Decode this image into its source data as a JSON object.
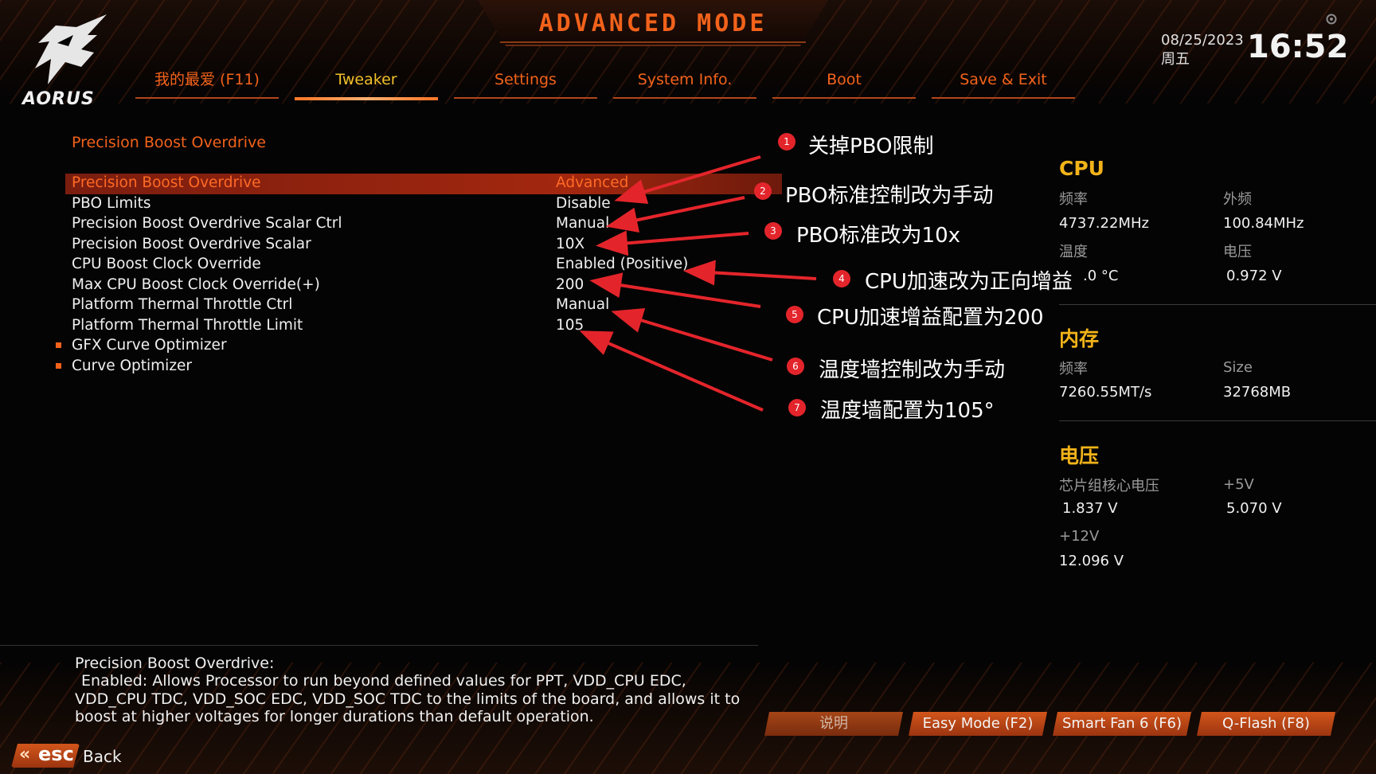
{
  "header": {
    "title": "ADVANCED MODE",
    "brand": "AORUS",
    "date": "08/25/2023",
    "weekday": "周五",
    "time": "16:52"
  },
  "tabs": [
    {
      "label": "我的最爱 (F11)",
      "active": false
    },
    {
      "label": "Tweaker",
      "active": true
    },
    {
      "label": "Settings",
      "active": false
    },
    {
      "label": "System Info.",
      "active": false
    },
    {
      "label": "Boot",
      "active": false
    },
    {
      "label": "Save & Exit",
      "active": false
    }
  ],
  "section_title": "Precision Boost Overdrive",
  "menu": [
    {
      "label": "Precision Boost Overdrive",
      "value": "Advanced",
      "selected": true
    },
    {
      "label": "PBO Limits",
      "value": "Disable"
    },
    {
      "label": "Precision Boost Overdrive Scalar Ctrl",
      "value": "Manual"
    },
    {
      "label": "Precision Boost Overdrive Scalar",
      "value": "10X"
    },
    {
      "label": "CPU Boost Clock Override",
      "value": "Enabled (Positive)"
    },
    {
      "label": "Max CPU Boost Clock Override(+)",
      "value": "200"
    },
    {
      "label": "Platform Thermal Throttle Ctrl",
      "value": "Manual"
    },
    {
      "label": "Platform Thermal Throttle Limit",
      "value": "105"
    },
    {
      "label": "GFX Curve Optimizer",
      "value": "",
      "submenu": true
    },
    {
      "label": "Curve Optimizer",
      "value": "",
      "submenu": true
    }
  ],
  "annotations": [
    {
      "num": "1",
      "text": "关掉PBO限制"
    },
    {
      "num": "2",
      "text": "PBO标准控制改为手动"
    },
    {
      "num": "3",
      "text": "PBO标准改为10x"
    },
    {
      "num": "4",
      "text": "CPU加速改为正向增益"
    },
    {
      "num": "5",
      "text": "CPU加速增益配置为200"
    },
    {
      "num": "6",
      "text": "温度墙控制改为手动"
    },
    {
      "num": "7",
      "text": "温度墙配置为105°"
    }
  ],
  "sidebar": {
    "cpu": {
      "title": "CPU",
      "freq_label": "频率",
      "freq_value": "4737.22MHz",
      "bclk_label": "外频",
      "bclk_value": "100.84MHz",
      "temp_label": "温度",
      "temp_value": ".0 °C",
      "volt_label": "电压",
      "volt_value": "0.972 V"
    },
    "memory": {
      "title": "内存",
      "freq_label": "频率",
      "freq_value": "7260.55MT/s",
      "size_label": "Size",
      "size_value": "32768MB"
    },
    "voltage": {
      "title": "电压",
      "chipset_label": "芯片组核心电压",
      "chipset_value": "1.837 V",
      "p5v_label": "+5V",
      "p5v_value": "5.070 V",
      "p12v_label": "+12V",
      "p12v_value": "12.096 V"
    }
  },
  "help": {
    "title": "Precision Boost Overdrive:",
    "lines": [
      "Enabled: Allows Processor to run beyond defined values for PPT, VDD_CPU EDC,",
      "VDD_CPU TDC, VDD_SOC EDC, VDD_SOC TDC to the limits of the board, and allows it to",
      "boost at higher voltages for longer durations than default operation."
    ]
  },
  "footer": {
    "buttons": [
      "说明",
      "Easy Mode (F2)",
      "Smart Fan 6 (F6)",
      "Q-Flash (F8)"
    ],
    "esc_label": "esc",
    "back_label": "Back"
  },
  "colors": {
    "accent": "#f2621b",
    "active_tab": "#f2c029",
    "sidebar_title": "#f2b319",
    "annotation_badge": "#e3252b",
    "arrow": "#e3252b"
  }
}
